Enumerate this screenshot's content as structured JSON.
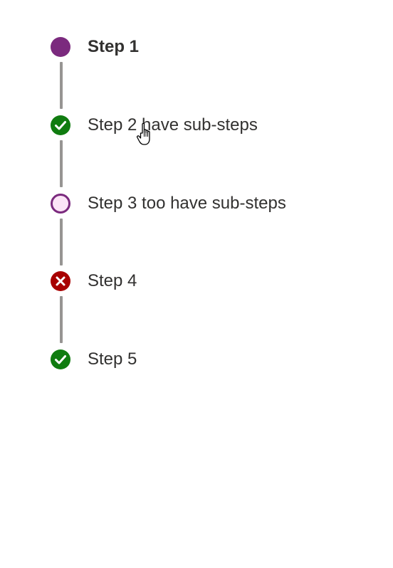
{
  "steps": [
    {
      "label": "Step 1",
      "state": "current",
      "icon": "current-step-dot-icon"
    },
    {
      "label": "Step 2 have sub-steps",
      "state": "completed",
      "icon": "checkmark-icon"
    },
    {
      "label": "Step 3 too have sub-steps",
      "state": "not-started",
      "icon": "empty-circle-icon"
    },
    {
      "label": "Step 4",
      "state": "error",
      "icon": "error-x-icon"
    },
    {
      "label": "Step 5",
      "state": "completed",
      "icon": "checkmark-icon"
    }
  ],
  "colors": {
    "current": "#7b2a7e",
    "completed": "#107c10",
    "not_started_fill": "#fce4f7",
    "not_started_border": "#7b2a7e",
    "error": "#a80000",
    "connector": "#979593",
    "text": "#323130"
  }
}
